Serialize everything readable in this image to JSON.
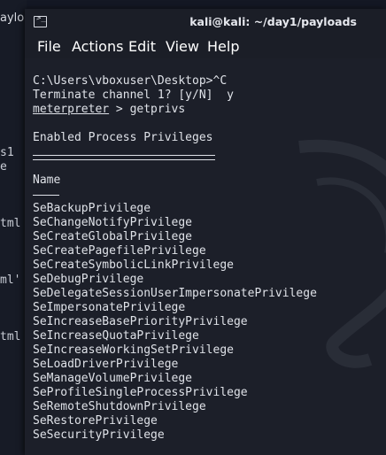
{
  "background_window": {
    "title_fragment": "ayload",
    "text_fragments": [
      "s1",
      "e",
      "tml",
      "ml'",
      "tml"
    ]
  },
  "window": {
    "title": "kali@kali: ~/day1/payloads"
  },
  "menu": [
    "File",
    "Actions",
    "Edit",
    "View",
    "Help"
  ],
  "terminal": {
    "lines": [
      "C:\\Users\\vboxuser\\Desktop>^C",
      "Terminate channel 1? [y/N]  y"
    ],
    "prompt": "meterpreter",
    "command": " > getprivs",
    "heading": "Enabled Process Privileges",
    "column_header": "Name",
    "privileges": [
      "SeBackupPrivilege",
      "SeChangeNotifyPrivilege",
      "SeCreateGlobalPrivilege",
      "SeCreatePagefilePrivilege",
      "SeCreateSymbolicLinkPrivilege",
      "SeDebugPrivilege",
      "SeDelegateSessionUserImpersonatePrivilege",
      "SeImpersonatePrivilege",
      "SeIncreaseBasePriorityPrivilege",
      "SeIncreaseQuotaPrivilege",
      "SeIncreaseWorkingSetPrivilege",
      "SeLoadDriverPrivilege",
      "SeManageVolumePrivilege",
      "SeProfileSingleProcessPrivilege",
      "SeRemoteShutdownPrivilege",
      "SeRestorePrivilege",
      "SeSecurityPrivilege"
    ]
  }
}
